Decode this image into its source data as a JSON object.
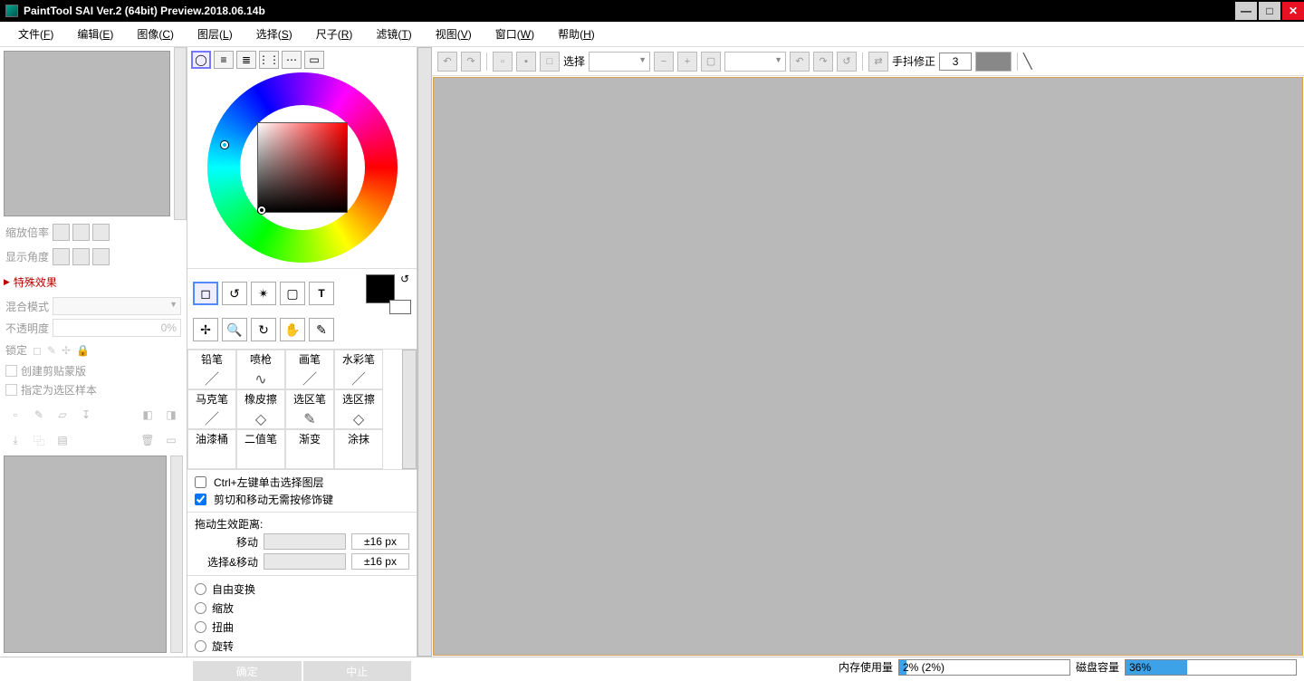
{
  "title": "PaintTool SAI Ver.2 (64bit) Preview.2018.06.14b",
  "menu": {
    "file": "文件(",
    "file_k": "F",
    "edit": "编辑(",
    "edit_k": "E",
    "image": "图像(",
    "image_k": "C",
    "layer": "图层(",
    "layer_k": "L",
    "select": "选择(",
    "select_k": "S",
    "size": "尺子(",
    "size_k": "R",
    "filter": "滤镜(",
    "filter_k": "T",
    "view": "视图(",
    "view_k": "V",
    "window": "窗口(",
    "window_k": "W",
    "help": "帮助(",
    "help_k": "H",
    "close": ")"
  },
  "nav": {
    "zoom": "缩放倍率",
    "angle": "显示角度"
  },
  "effects_header": "特殊效果",
  "blend_label": "混合模式",
  "opacity_label": "不透明度",
  "opacity_value": "0%",
  "lock_label": "锁定",
  "clip_label": "创建剪贴蒙版",
  "sample_label": "指定为选区样本",
  "brushes": [
    "铅笔",
    "喷枪",
    "画笔",
    "水彩笔",
    "马克笔",
    "橡皮擦",
    "选区笔",
    "选区擦",
    "油漆桶",
    "二值笔",
    "渐变",
    "涂抹"
  ],
  "opt_ctrl": "Ctrl+左键单击选择图层",
  "opt_cut": "剪切和移动无需按修饰键",
  "drag_label": "拖动生效距离:",
  "move_label": "移动",
  "selmove_label": "选择&移动",
  "px_value": "±16 px",
  "transform": {
    "free": "自由变换",
    "scale": "缩放",
    "distort": "扭曲",
    "rotate": "旋转"
  },
  "btn_ok": "确定",
  "btn_cancel": "中止",
  "tb_select": "选择",
  "stab_label": "手抖修正",
  "stab_value": "3",
  "status_mem_label": "内存使用量",
  "status_mem_value": "2% (2%)",
  "status_disk_label": "磁盘容量",
  "status_disk_value": "36%"
}
